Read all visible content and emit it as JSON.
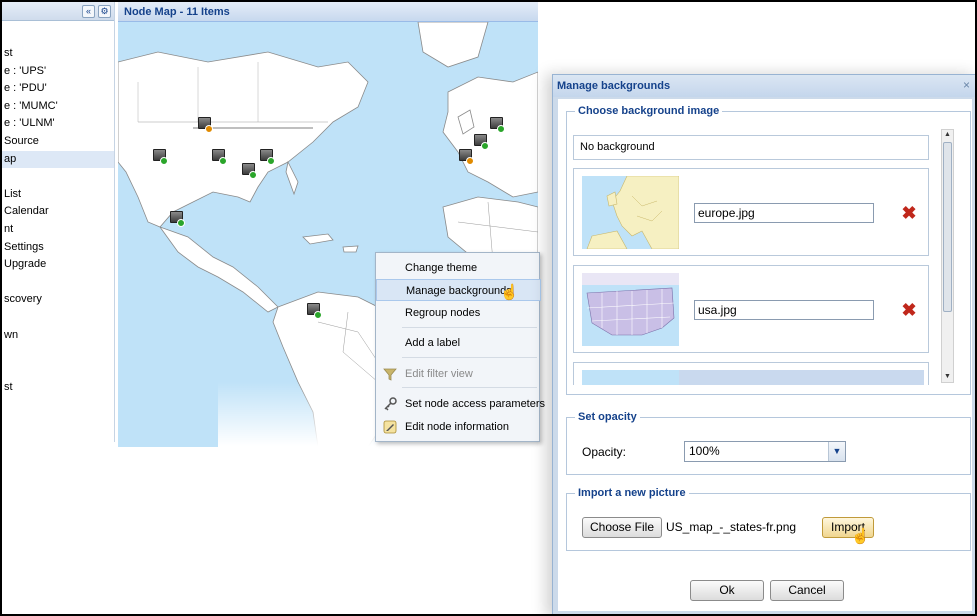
{
  "sidebar": {
    "items": [
      {
        "label": "st"
      },
      {
        "label": "e : 'UPS'"
      },
      {
        "label": "e : 'PDU'"
      },
      {
        "label": "e : 'MUMC'"
      },
      {
        "label": "e : 'ULNM'"
      },
      {
        "label": "Source"
      },
      {
        "label": "ap"
      },
      {
        "label": ""
      },
      {
        "label": "List"
      },
      {
        "label": "Calendar"
      },
      {
        "label": "nt"
      },
      {
        "label": "Settings"
      },
      {
        "label": "Upgrade"
      },
      {
        "label": ""
      },
      {
        "label": "scovery"
      },
      {
        "label": ""
      },
      {
        "label": "wn"
      },
      {
        "label": ""
      },
      {
        "label": ""
      },
      {
        "label": "st"
      }
    ],
    "collapse_glyph": "«",
    "settings_glyph": "⚙"
  },
  "map": {
    "title": "Node Map - 11 Items"
  },
  "context_menu": {
    "items": [
      {
        "label": "Change theme",
        "icon": ""
      },
      {
        "label": "Manage backgrounds",
        "icon": ""
      },
      {
        "label": "Regroup nodes",
        "icon": ""
      },
      {
        "label": "Add a label",
        "icon": ""
      },
      {
        "label": "Edit filter view",
        "icon": "filter-icon"
      },
      {
        "label": "Set node access parameters",
        "icon": "key-icon"
      },
      {
        "label": "Edit node information",
        "icon": "edit-icon"
      }
    ]
  },
  "dialog": {
    "title": "Manage backgrounds",
    "close_glyph": "×",
    "background_section": {
      "legend": "Choose background image",
      "no_background": "No background",
      "items": [
        {
          "filename": "europe.jpg"
        },
        {
          "filename": "usa.jpg"
        }
      ]
    },
    "opacity_section": {
      "legend": "Set opacity",
      "label": "Opacity:",
      "value": "100%"
    },
    "import_section": {
      "legend": "Import a new picture",
      "choose_file_label": "Choose File",
      "selected_file": "US_map_-_states-fr.png",
      "import_label": "Import"
    },
    "footer": {
      "ok_label": "Ok",
      "cancel_label": "Cancel"
    }
  },
  "colors": {
    "accent": "#15428b",
    "ocean": "#bfe2f8",
    "land": "#ffffff",
    "delete": "#c0271b",
    "status_ok": "#2aa52a",
    "status_warn": "#e08a00"
  }
}
